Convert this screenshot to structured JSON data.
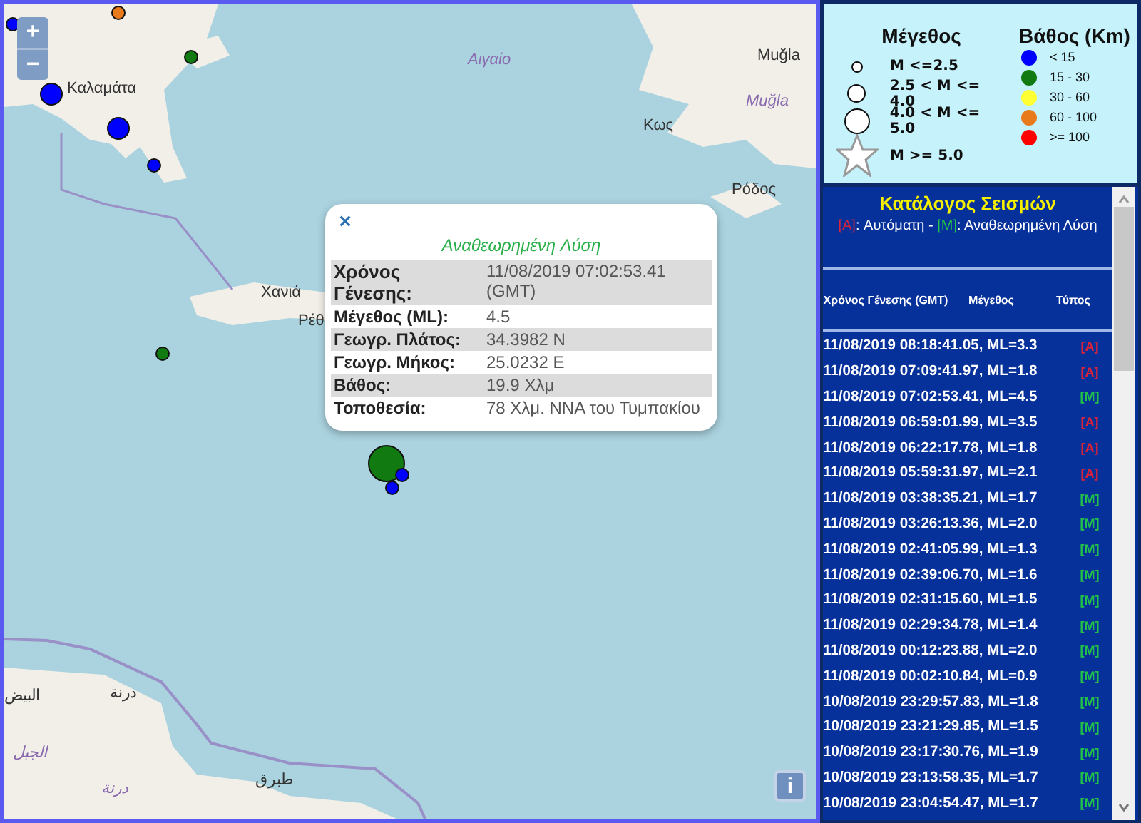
{
  "map": {
    "zoom_in": "+",
    "zoom_out": "−",
    "info": "i",
    "labels": [
      {
        "text": "Καλαμάτα",
        "kind": "city"
      },
      {
        "text": "Αιγαίο",
        "kind": "sea"
      },
      {
        "text": "Muğla",
        "kind": "city"
      },
      {
        "text": "Muğla",
        "kind": "region"
      },
      {
        "text": "Κως",
        "kind": "city"
      },
      {
        "text": "Ρόδος",
        "kind": "city"
      },
      {
        "text": "Χανιά",
        "kind": "city"
      },
      {
        "text": "Ρέθ",
        "kind": "city"
      },
      {
        "text": "البيض",
        "kind": "city"
      },
      {
        "text": "درنة",
        "kind": "city"
      },
      {
        "text": "الجبل",
        "kind": "region"
      },
      {
        "text": "درنة",
        "kind": "region"
      },
      {
        "text": "طبرق",
        "kind": "city"
      }
    ],
    "markers": [
      {
        "color": "#e87a1c",
        "kind": "small"
      },
      {
        "color": "#0000ff",
        "kind": "small"
      },
      {
        "color": "#117a11",
        "kind": "small"
      },
      {
        "color": "#0000ff",
        "kind": "medium"
      },
      {
        "color": "#0000ff",
        "kind": "medium"
      },
      {
        "color": "#0000ff",
        "kind": "small"
      },
      {
        "color": "#117a11",
        "kind": "small"
      },
      {
        "color": "#117a11",
        "kind": "large"
      },
      {
        "color": "#0000ff",
        "kind": "small"
      },
      {
        "color": "#0000ff",
        "kind": "small"
      }
    ],
    "popup": {
      "close": "×",
      "title": "Αναθεωρημένη Λύση",
      "rows": [
        {
          "label": "Χρόνος Γένεσης:",
          "value": "11/08/2019 07:02:53.41 (GMT)"
        },
        {
          "label": "Μέγεθος (ML):",
          "value": "4.5"
        },
        {
          "label": "Γεωγρ. Πλάτος:",
          "value": "34.3982 N"
        },
        {
          "label": "Γεωγρ. Μήκος:",
          "value": "25.0232 E"
        },
        {
          "label": "Βάθος:",
          "value": "19.9 Χλμ"
        },
        {
          "label": "Τοποθεσία:",
          "value": "78 Χλμ. ΝΝΑ του Τυμπακίου"
        }
      ]
    }
  },
  "legend": {
    "magnitude_title": "Μέγεθος",
    "depth_title": "Βάθος (Km)",
    "magnitude": [
      {
        "kind": "small",
        "label": "M <=2.5"
      },
      {
        "kind": "medium",
        "label": "2.5 < M <= 4.0"
      },
      {
        "kind": "large",
        "label": "4.0 < M <= 5.0"
      },
      {
        "kind": "star",
        "label": "M >= 5.0"
      }
    ],
    "depth": [
      {
        "color": "#0000ff",
        "label": "< 15"
      },
      {
        "color": "#117a11",
        "label": "15 - 30"
      },
      {
        "color": "#ffff33",
        "label": "30 - 60"
      },
      {
        "color": "#e87a1c",
        "label": "60 - 100"
      },
      {
        "color": "#ff0000",
        "label": ">= 100"
      }
    ]
  },
  "catalog": {
    "title": "Κατάλογος Σεισμών",
    "key": [
      {
        "kind": "auto",
        "code": "[A]",
        "text": ": Αυτόματη -"
      },
      {
        "kind": "manual",
        "code": "[M]",
        "text": ": Αναθεωρημένη Λύση"
      }
    ],
    "columns": [
      "Χρόνος Γένεσης (GMT)",
      "Μέγεθος",
      "Τύπος"
    ],
    "rows": [
      {
        "text": "11/08/2019 08:18:41.05, ML=3.3",
        "type": "[A]",
        "kind": "auto"
      },
      {
        "text": "11/08/2019 07:09:41.97, ML=1.8",
        "type": "[A]",
        "kind": "auto"
      },
      {
        "text": "11/08/2019 07:02:53.41, ML=4.5",
        "type": "[M]",
        "kind": "manual"
      },
      {
        "text": "11/08/2019 06:59:01.99, ML=3.5",
        "type": "[A]",
        "kind": "auto"
      },
      {
        "text": "11/08/2019 06:22:17.78, ML=1.8",
        "type": "[A]",
        "kind": "auto"
      },
      {
        "text": "11/08/2019 05:59:31.97, ML=2.1",
        "type": "[A]",
        "kind": "auto"
      },
      {
        "text": "11/08/2019 03:38:35.21, ML=1.7",
        "type": "[M]",
        "kind": "manual"
      },
      {
        "text": "11/08/2019 03:26:13.36, ML=2.0",
        "type": "[M]",
        "kind": "manual"
      },
      {
        "text": "11/08/2019 02:41:05.99, ML=1.3",
        "type": "[M]",
        "kind": "manual"
      },
      {
        "text": "11/08/2019 02:39:06.70, ML=1.6",
        "type": "[M]",
        "kind": "manual"
      },
      {
        "text": "11/08/2019 02:31:15.60, ML=1.5",
        "type": "[M]",
        "kind": "manual"
      },
      {
        "text": "11/08/2019 02:29:34.78, ML=1.4",
        "type": "[M]",
        "kind": "manual"
      },
      {
        "text": "11/08/2019 00:12:23.88, ML=2.0",
        "type": "[M]",
        "kind": "manual"
      },
      {
        "text": "11/08/2019 00:02:10.84, ML=0.9",
        "type": "[M]",
        "kind": "manual"
      },
      {
        "text": "10/08/2019 23:29:57.83, ML=1.8",
        "type": "[M]",
        "kind": "manual"
      },
      {
        "text": "10/08/2019 23:21:29.85, ML=1.5",
        "type": "[M]",
        "kind": "manual"
      },
      {
        "text": "10/08/2019 23:17:30.76, ML=1.9",
        "type": "[M]",
        "kind": "manual"
      },
      {
        "text": "10/08/2019 23:13:58.35, ML=1.7",
        "type": "[M]",
        "kind": "manual"
      },
      {
        "text": "10/08/2019 23:04:54.47, ML=1.7",
        "type": "[M]",
        "kind": "manual"
      }
    ]
  }
}
